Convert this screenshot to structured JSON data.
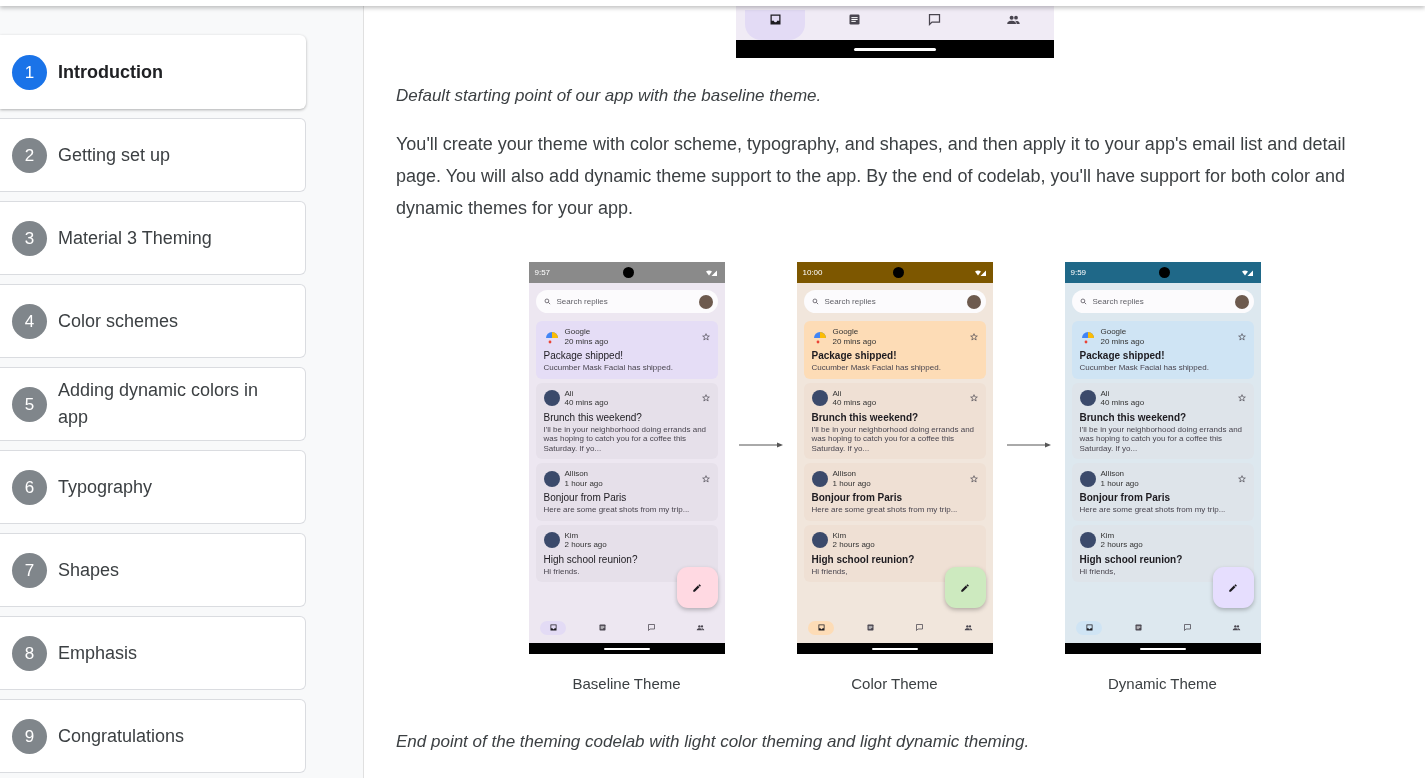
{
  "top_phone": {
    "nav_items": [
      {
        "kind": "inbox",
        "selected": true
      },
      {
        "kind": "articles",
        "selected": false
      },
      {
        "kind": "chat",
        "selected": false
      },
      {
        "kind": "people",
        "selected": false
      }
    ]
  },
  "sidebar": {
    "steps": [
      {
        "number": "1",
        "label": "Introduction",
        "selected": true
      },
      {
        "number": "2",
        "label": "Getting set up",
        "selected": false
      },
      {
        "number": "3",
        "label": "Material 3 Theming",
        "selected": false
      },
      {
        "number": "4",
        "label": "Color schemes",
        "selected": false
      },
      {
        "number": "5",
        "label": "Adding dynamic colors in app",
        "selected": false
      },
      {
        "number": "6",
        "label": "Typography",
        "selected": false
      },
      {
        "number": "7",
        "label": "Shapes",
        "selected": false
      },
      {
        "number": "8",
        "label": "Emphasis",
        "selected": false
      },
      {
        "number": "9",
        "label": "Congratulations",
        "selected": false
      }
    ]
  },
  "content": {
    "intro_caption": "Default starting point of our app with the baseline theme.",
    "paragraph": "You'll create your theme with color scheme, typography, and shapes, and then apply it to your app's email list and detail page. You will also add dynamic theme support to the app. By the end of codelab, you'll have support for both color and dynamic themes for your app.",
    "phones": [
      {
        "kind": "baseline",
        "status_time": "9:57",
        "search_placeholder": "Search replies",
        "caption": "Baseline Theme",
        "emails": [
          {
            "kind": "logo",
            "sender": "Google",
            "time": "20 mins ago",
            "subject": "Package shipped!",
            "preview": "Cucumber Mask Facial has shipped.",
            "starred": false
          },
          {
            "kind": "avatar",
            "sender": "Ali",
            "time": "40 mins ago",
            "subject": "Brunch this weekend?",
            "preview": "I'll be in your neighborhood doing errands and was hoping to catch you for a coffee this Saturday. If yo...",
            "starred": false
          },
          {
            "kind": "avatar",
            "sender": "Allison",
            "time": "1 hour ago",
            "subject": "Bonjour from Paris",
            "preview": "Here are some great shots from my trip...",
            "starred": false
          },
          {
            "kind": "avatar",
            "sender": "Kim",
            "time": "2 hours ago",
            "subject": "High school reunion?",
            "preview": "Hi friends."
          }
        ],
        "nav_items": [
          {
            "kind": "inbox",
            "selected": true
          },
          {
            "kind": "articles",
            "selected": false
          },
          {
            "kind": "chat",
            "selected": false
          },
          {
            "kind": "people",
            "selected": false
          }
        ]
      },
      {
        "kind": "color",
        "status_time": "10:00",
        "search_placeholder": "Search replies",
        "caption": "Color Theme",
        "emails": [
          {
            "kind": "logo",
            "sender": "Google",
            "time": "20 mins ago",
            "subject": "Package shipped!",
            "preview": "Cucumber Mask Facial has shipped.",
            "starred": false
          },
          {
            "kind": "avatar",
            "sender": "Ali",
            "time": "40 mins ago",
            "subject": "Brunch this weekend?",
            "preview": "I'll be in your neighborhood doing errands and was hoping to catch you for a coffee this Saturday. If yo...",
            "starred": false
          },
          {
            "kind": "avatar",
            "sender": "Allison",
            "time": "1 hour ago",
            "subject": "Bonjour from Paris",
            "preview": "Here are some great shots from my trip...",
            "starred": false
          },
          {
            "kind": "avatar",
            "sender": "Kim",
            "time": "2 hours ago",
            "subject": "High school reunion?",
            "preview": "Hi friends,"
          }
        ],
        "nav_items": [
          {
            "kind": "inbox",
            "selected": true
          },
          {
            "kind": "articles",
            "selected": false
          },
          {
            "kind": "chat",
            "selected": false
          },
          {
            "kind": "people",
            "selected": false
          }
        ]
      },
      {
        "kind": "dynamic",
        "status_time": "9:59",
        "search_placeholder": "Search replies",
        "caption": "Dynamic Theme",
        "emails": [
          {
            "kind": "logo",
            "sender": "Google",
            "time": "20 mins ago",
            "subject": "Package shipped!",
            "preview": "Cucumber Mask Facial has shipped.",
            "starred": false
          },
          {
            "kind": "avatar",
            "sender": "Ali",
            "time": "40 mins ago",
            "subject": "Brunch this weekend?",
            "preview": "I'll be in your neighborhood doing errands and was hoping to catch you for a coffee this Saturday. If yo...",
            "starred": false
          },
          {
            "kind": "avatar",
            "sender": "Allison",
            "time": "1 hour ago",
            "subject": "Bonjour from Paris",
            "preview": "Here are some great shots from my trip...",
            "starred": false
          },
          {
            "kind": "avatar",
            "sender": "Kim",
            "time": "2 hours ago",
            "subject": "High school reunion?",
            "preview": "Hi friends,"
          }
        ],
        "nav_items": [
          {
            "kind": "inbox",
            "selected": true
          },
          {
            "kind": "articles",
            "selected": false
          },
          {
            "kind": "chat",
            "selected": false
          },
          {
            "kind": "people",
            "selected": false
          }
        ]
      }
    ],
    "closing_caption": "End point of the theming codelab with light color theming and light dynamic theming."
  }
}
